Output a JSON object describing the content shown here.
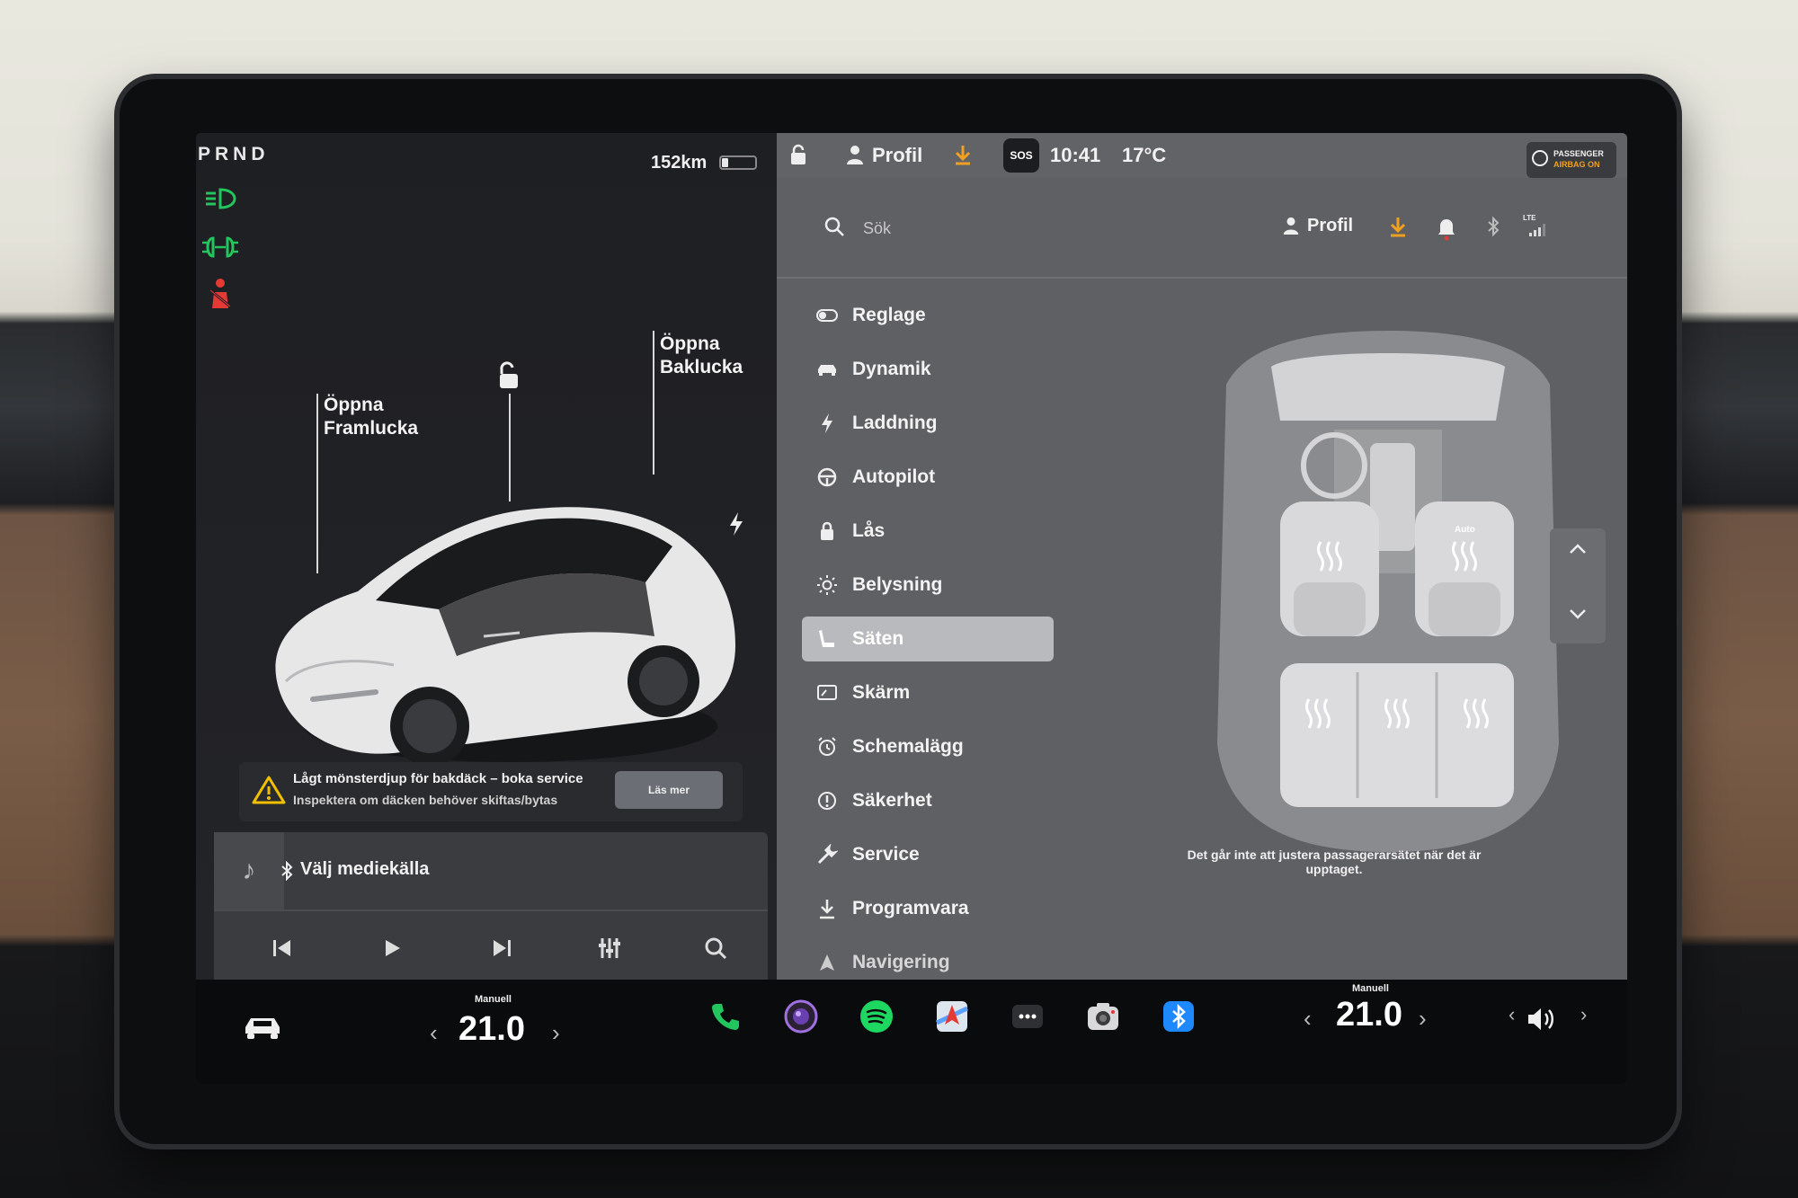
{
  "status_bar": {
    "gear": "PRND",
    "range": "152km",
    "battery_fraction": 0.2
  },
  "vehicle": {
    "callouts": [
      {
        "line1": "Öppna",
        "line2": "Framlucka"
      },
      {
        "line1": "Öppna",
        "line2": "Baklucka"
      }
    ]
  },
  "alert": {
    "title": "Lågt mönsterdjup för bakdäck – boka service",
    "subtitle": "Inspektera om däcken behöver skiftas/bytas",
    "button": "Läs mer"
  },
  "media": {
    "source_label": "Välj mediekälla"
  },
  "right_top": {
    "profile": "Profil",
    "sos": "SOS",
    "time": "10:41",
    "temp": "17°C",
    "airbag_line1": "PASSENGER",
    "airbag_line2": "AIRBAG ON"
  },
  "search": {
    "placeholder": "Sök",
    "profile": "Profil",
    "lte": "LTE"
  },
  "menu": {
    "items": [
      {
        "label": "Reglage",
        "icon": "toggle-icon"
      },
      {
        "label": "Dynamik",
        "icon": "car-icon"
      },
      {
        "label": "Laddning",
        "icon": "bolt-icon"
      },
      {
        "label": "Autopilot",
        "icon": "steering-wheel-icon"
      },
      {
        "label": "Lås",
        "icon": "lock-icon"
      },
      {
        "label": "Belysning",
        "icon": "sun-icon"
      },
      {
        "label": "Säten",
        "icon": "seat-icon",
        "active": true
      },
      {
        "label": "Skärm",
        "icon": "display-icon"
      },
      {
        "label": "Schemalägg",
        "icon": "alarm-icon"
      },
      {
        "label": "Säkerhet",
        "icon": "info-icon"
      },
      {
        "label": "Service",
        "icon": "wrench-icon"
      },
      {
        "label": "Programvara",
        "icon": "download-icon"
      },
      {
        "label": "Navigering",
        "icon": "navigation-icon"
      }
    ]
  },
  "seats": {
    "auto_label": "Auto",
    "note": "Det går inte att justera passagerarsätet när det är upptaget."
  },
  "bottom_bar": {
    "driver_temp_label": "Manuell",
    "driver_temp": "21.0",
    "passenger_temp_label": "Manuell",
    "passenger_temp": "21.0",
    "apps": [
      "phone-icon",
      "camera-lens-icon",
      "spotify-icon",
      "maps-icon",
      "more-icon",
      "dashcam-icon",
      "bluetooth-icon"
    ]
  },
  "colors": {
    "green": "#22c55e",
    "red": "#e53935",
    "orange": "#f0a020",
    "bluetooth": "#1e88ff",
    "spotify": "#1ed760"
  }
}
